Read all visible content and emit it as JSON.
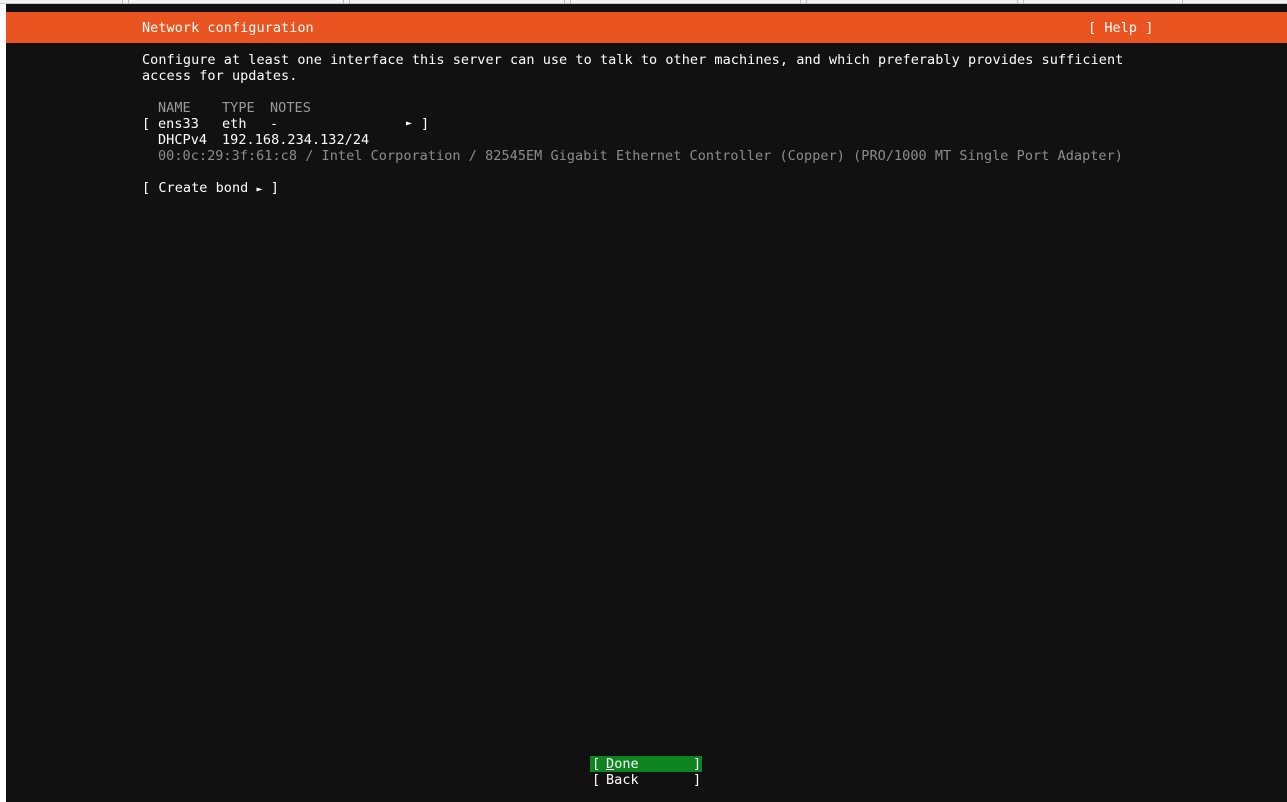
{
  "screen": {
    "title": "Network configuration",
    "help_label": "[ Help ]",
    "intro_line_1": "Configure at least one interface this server can use to talk to other machines, and which preferably provides sufficient",
    "intro_line_2": "access for updates."
  },
  "interfaces": {
    "headers": {
      "name": "NAME",
      "type": "TYPE",
      "notes": "NOTES"
    },
    "rows": [
      {
        "bracket_left": "[",
        "name": "ens33",
        "type": "eth",
        "notes": "-",
        "arrow": "►",
        "bracket_right": "]",
        "addr_proto": "DHCPv4",
        "addr_value": "192.168.234.132/24",
        "hardware": "00:0c:29:3f:61:c8 / Intel Corporation / 82545EM Gigabit Ethernet Controller (Copper) (PRO/1000 MT Single Port Adapter)"
      }
    ]
  },
  "actions": {
    "create_bond_prefix": "[ Create bond ",
    "create_bond_arrow": "►",
    "create_bond_suffix": " ]",
    "done_open": "[ ",
    "done_first": "D",
    "done_rest": "one",
    "done_close": "]",
    "back_open": "[ ",
    "back_label": "Back",
    "back_close": "]"
  },
  "colors": {
    "accent": "#e95420",
    "background": "#111111",
    "done_button": "#0e8420"
  }
}
